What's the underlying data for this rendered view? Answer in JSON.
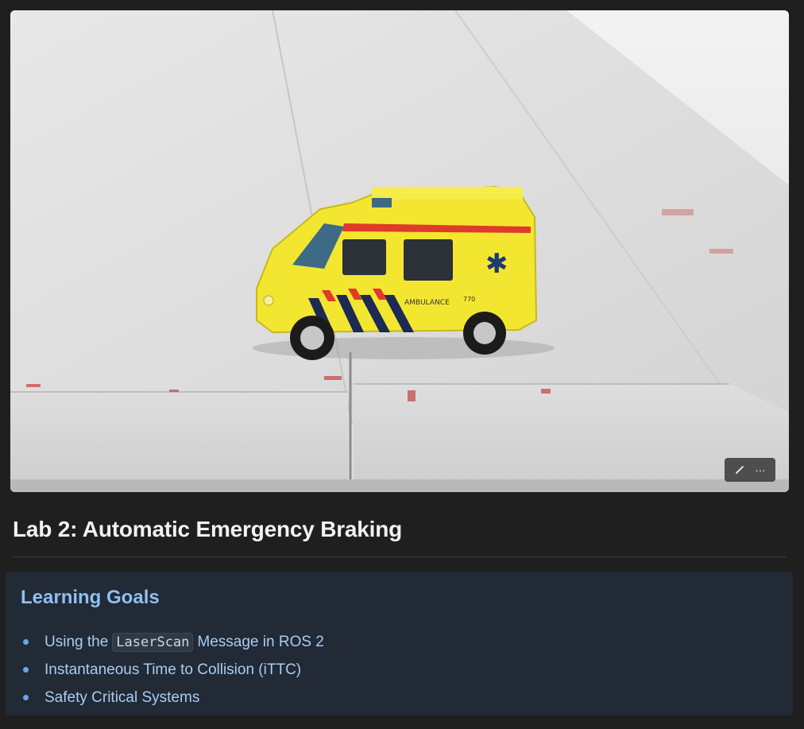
{
  "cover": {
    "image_label": "yellow toy ambulance on white wooden table",
    "vehicle_text": "AMBULANCE",
    "vehicle_number": "770",
    "actions": {
      "edit_icon": "pencil-icon",
      "more_icon": "ellipsis-icon",
      "more_label": "···"
    }
  },
  "page": {
    "title": "Lab 2: Automatic Emergency Braking"
  },
  "callout": {
    "heading": "Learning Goals",
    "goals": [
      {
        "prefix": "Using the",
        "code": "LaserScan",
        "suffix": "Message in ROS 2"
      },
      {
        "text": "Instantaneous Time to Collision (iTTC)"
      },
      {
        "text": "Safety Critical Systems"
      }
    ]
  },
  "colors": {
    "page_bg": "#1f1f1f",
    "callout_bg": "#212a35",
    "heading_blue": "#8fbff2",
    "list_blue": "#a9cdf3",
    "ambulance_yellow": "#f3e631"
  }
}
